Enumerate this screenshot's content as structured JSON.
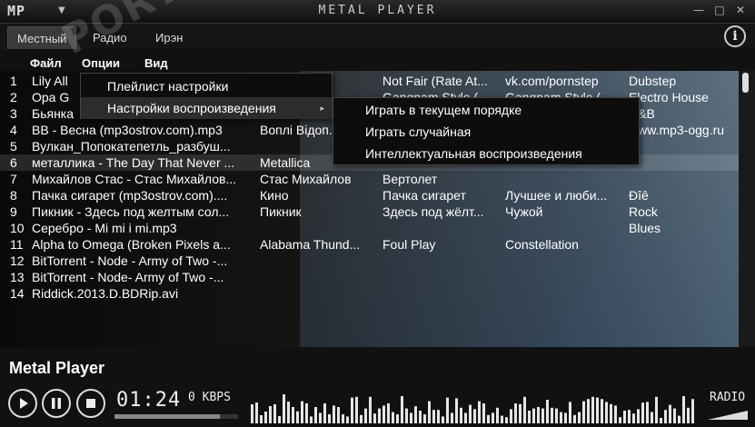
{
  "window": {
    "logo": "MP",
    "title": "METAL PLAYER",
    "min_glyph": "—",
    "max_glyph": "□",
    "close_glyph": "✕"
  },
  "tabs": [
    {
      "label": "Местный",
      "active": true
    },
    {
      "label": "Радио",
      "active": false
    },
    {
      "label": "Ирэн",
      "active": false
    }
  ],
  "info_glyph": "i",
  "menubar": [
    {
      "label": "Файл"
    },
    {
      "label": "Опции"
    },
    {
      "label": "Вид"
    }
  ],
  "context_menu": {
    "items": [
      {
        "label": "Плейлист настройки"
      },
      {
        "label": "Настройки воспроизведения",
        "arrow": "▸",
        "active": true
      }
    ],
    "submenu": [
      {
        "label": "Играть в текущем порядке"
      },
      {
        "label": "Играть случайная"
      },
      {
        "label": "Интеллектуальная воспроизведения"
      }
    ]
  },
  "watermark": {
    "text": "PORTAL",
    "tm": "™"
  },
  "playlist": [
    {
      "num": "1",
      "title": "Lily All",
      "artist": "",
      "album": "Not Fair (Rate At...",
      "genre2": "vk.com/pornstep",
      "genre": "Dubstep"
    },
    {
      "num": "2",
      "title": "Opa G",
      "artist": "",
      "album": "Gangnam Style (...",
      "genre2": "Gangnam Style (...",
      "genre": "Electro House"
    },
    {
      "num": "3",
      "title": "Бьянка",
      "artist": "",
      "album": "",
      "genre2": "",
      "genre": "R&B"
    },
    {
      "num": "4",
      "title": "BB - Весна (mp3ostrov.com).mp3",
      "artist": "Воплі Відоп...",
      "album": "",
      "genre2": "",
      "genre": "www.mp3-ogg.ru"
    },
    {
      "num": "5",
      "title": "Вулкан_Попокатепетль_разбуш...",
      "artist": "",
      "album": "",
      "genre2": "",
      "genre": ""
    },
    {
      "num": "6",
      "title": "металлика - The Day That Never ...",
      "artist": "Metallica",
      "album": "",
      "genre2": "",
      "genre": ""
    },
    {
      "num": "7",
      "title": "Михайлов Стас - Стас Михайлов...",
      "artist": "Стас Михайлов",
      "album": "Вертолет",
      "genre2": "",
      "genre": ""
    },
    {
      "num": "8",
      "title": "Пачка сигарет (mp3ostrov.com)....",
      "artist": "Кино",
      "album": "Пачка сигарет",
      "genre2": "Лучшее и люби...",
      "genre": "Ðîê"
    },
    {
      "num": "9",
      "title": "Пикник - Здесь под желтым сол...",
      "artist": "Пикник",
      "album": "Здесь под жёлт...",
      "genre2": "Чужой",
      "genre": "Rock"
    },
    {
      "num": "10",
      "title": "Серебро - Mi mi i mi.mp3",
      "artist": "",
      "album": "",
      "genre2": "",
      "genre": "Blues"
    },
    {
      "num": "11",
      "title": "Alpha to Omega (Broken Pixels a...",
      "artist": "Alabama Thund...",
      "album": "Foul Play",
      "genre2": "Constellation",
      "genre": ""
    },
    {
      "num": "12",
      "title": "BitTorrent - Node - Army of Two -...",
      "artist": "",
      "album": "",
      "genre2": "",
      "genre": ""
    },
    {
      "num": "13",
      "title": "BitTorrent - Node- Army of Two -...",
      "artist": "",
      "album": "",
      "genre2": "",
      "genre": ""
    },
    {
      "num": "14",
      "title": "Riddick.2013.D.BDRip.avi",
      "artist": "",
      "album": "",
      "genre2": "",
      "genre": ""
    }
  ],
  "player": {
    "now_playing": "Metal Player",
    "time": "01:24",
    "kbps": "0 KBPS",
    "radio": "RADIO",
    "progress": 0.85
  }
}
